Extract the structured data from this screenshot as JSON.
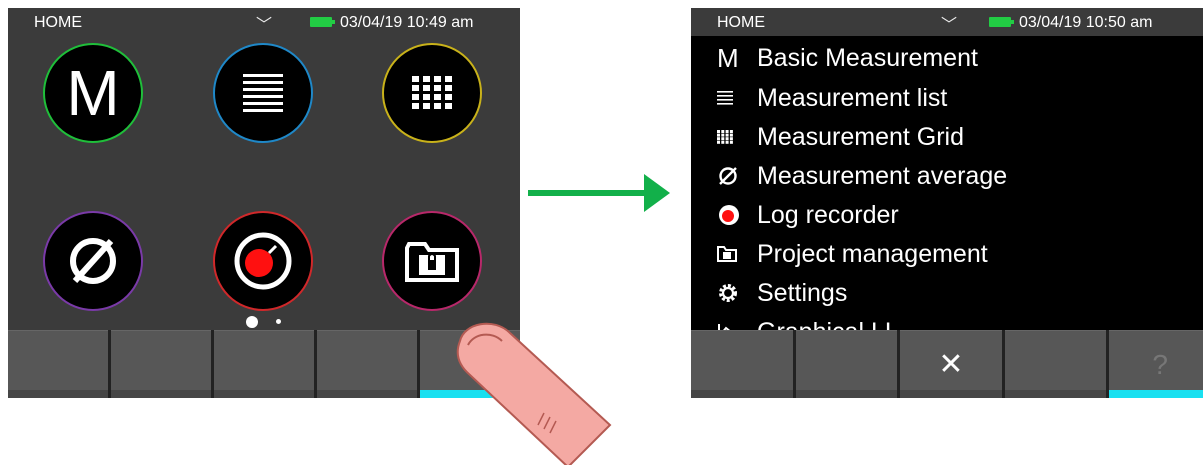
{
  "left_screen": {
    "status": {
      "title": "HOME",
      "chevron": "﹀",
      "datetime": "03/04/19 10:49 am"
    },
    "apps": [
      {
        "name": "basic-measurement",
        "glyph": "M",
        "ring": "#1fbf3a"
      },
      {
        "name": "measurement-list",
        "glyph": "list-icon",
        "ring": "#1f88c8"
      },
      {
        "name": "measurement-grid",
        "glyph": "grid-icon",
        "ring": "#c9b21a"
      },
      {
        "name": "measurement-average",
        "glyph": "⌀",
        "ring": "#7a3aa8"
      },
      {
        "name": "log-recorder",
        "glyph": "record-icon",
        "ring": "#d0282a"
      },
      {
        "name": "project-management",
        "glyph": "folder-lock-icon",
        "ring": "#b8286a"
      }
    ],
    "pager": {
      "pages": 2,
      "active": 1
    },
    "softkeys": [
      "",
      "",
      "",
      "",
      "?"
    ]
  },
  "right_screen": {
    "status": {
      "title": "HOME",
      "chevron": "﹀",
      "datetime": "03/04/19 10:50 am"
    },
    "menu": [
      {
        "icon": "M",
        "label": "Basic Measurement"
      },
      {
        "icon": "list-icon",
        "label": "Measurement list"
      },
      {
        "icon": "grid-icon",
        "label": "Measurement Grid"
      },
      {
        "icon": "⌀",
        "label": "Measurement average"
      },
      {
        "icon": "record-icon",
        "label": "Log recorder"
      },
      {
        "icon": "folder-lock-icon",
        "label": "Project management"
      },
      {
        "icon": "gear-icon",
        "label": "Settings"
      },
      {
        "icon": "graph-icon",
        "label": "Graphical LL"
      }
    ],
    "softkeys": [
      "",
      "",
      "✕",
      "",
      "?"
    ]
  },
  "colors": {
    "arrow": "#12b04a",
    "active_softkey": "#19e0f0",
    "record": "#ff1010"
  }
}
